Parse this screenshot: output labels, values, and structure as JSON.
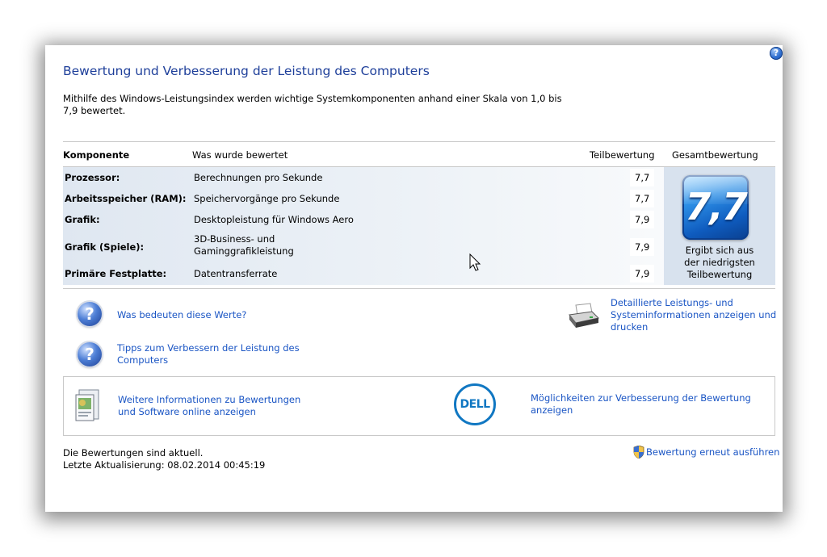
{
  "header": {
    "title": "Bewertung und Verbesserung der Leistung des Computers",
    "intro": "Mithilfe des Windows-Leistungsindex werden wichtige Systemkomponenten anhand einer Skala von 1,0 bis 7,9 bewertet."
  },
  "help": {
    "glyph": "?"
  },
  "table": {
    "headers": {
      "component": "Komponente",
      "what": "Was wurde bewertet",
      "subscore": "Teilbewertung",
      "total": "Gesamtbewertung"
    },
    "rows": [
      {
        "component": "Prozessor:",
        "what": "Berechnungen pro Sekunde",
        "score": "7,7"
      },
      {
        "component": "Arbeitsspeicher (RAM):",
        "what": "Speichervorgänge pro Sekunde",
        "score": "7,7"
      },
      {
        "component": "Grafik:",
        "what": "Desktopleistung für Windows Aero",
        "score": "7,9"
      },
      {
        "component": "Grafik (Spiele):",
        "what_line1": "3D-Business- und",
        "what_line2": "Gaminggrafikleistung",
        "score": "7,9"
      },
      {
        "component": "Primäre Festplatte:",
        "what": "Datentransferrate",
        "score": "7,9"
      }
    ],
    "total_score": "7,7",
    "total_caption_line1": "Ergibt sich aus",
    "total_caption_line2": "der niedrigsten",
    "total_caption_line3": "Teilbewertung"
  },
  "links": {
    "what_mean": "Was bedeuten diese Werte?",
    "tips_line1": "Tipps zum Verbessern der Leistung des",
    "tips_line2": "Computers",
    "details_line1": "Detaillierte Leistungs- und",
    "details_line2": "Systeminformationen anzeigen und",
    "details_line3": "drucken",
    "more_info_line1": "Weitere Informationen zu Bewertungen",
    "more_info_line2": "und Software online anzeigen",
    "improve_line1": "Möglichkeiten zur Verbesserung der Bewertung",
    "improve_line2": "anzeigen",
    "rerun": "Bewertung erneut ausführen"
  },
  "dell_logo_text": "DELL",
  "status": {
    "line1": "Die Bewertungen sind aktuell.",
    "line2": "Letzte Aktualisierung: 08.02.2014 00:45:19"
  },
  "icons": {
    "help": "help-icon",
    "question": "question-icon",
    "printer": "printer-icon",
    "shield": "uac-shield-icon",
    "info": "software-info-icon",
    "cursor": "mouse-cursor-icon"
  }
}
